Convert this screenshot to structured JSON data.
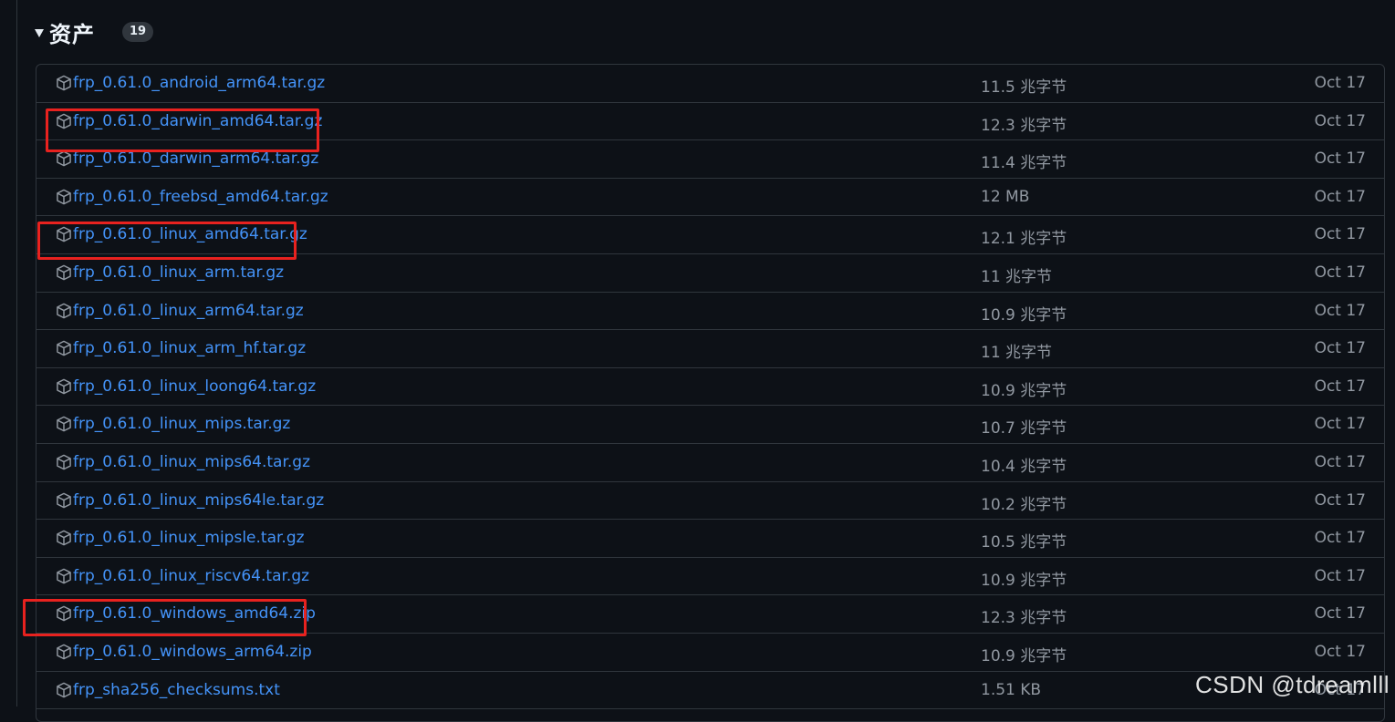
{
  "section": {
    "title": "资产",
    "count": "19"
  },
  "assets": [
    {
      "name": "frp_0.61.0_android_arm64.tar.gz",
      "size": "11.5 兆字节",
      "date": "Oct 17",
      "highlighted": false
    },
    {
      "name": "frp_0.61.0_darwin_amd64.tar.gz",
      "size": "12.3 兆字节",
      "date": "Oct 17",
      "highlighted": true
    },
    {
      "name": "frp_0.61.0_darwin_arm64.tar.gz",
      "size": "11.4 兆字节",
      "date": "Oct 17",
      "highlighted": false
    },
    {
      "name": "frp_0.61.0_freebsd_amd64.tar.gz",
      "size": "12 MB",
      "date": "Oct 17",
      "highlighted": false
    },
    {
      "name": "frp_0.61.0_linux_amd64.tar.gz",
      "size": "12.1 兆字节",
      "date": "Oct 17",
      "highlighted": true
    },
    {
      "name": "frp_0.61.0_linux_arm.tar.gz",
      "size": "11 兆字节",
      "date": "Oct 17",
      "highlighted": false
    },
    {
      "name": "frp_0.61.0_linux_arm64.tar.gz",
      "size": "10.9 兆字节",
      "date": "Oct 17",
      "highlighted": false
    },
    {
      "name": "frp_0.61.0_linux_arm_hf.tar.gz",
      "size": "11 兆字节",
      "date": "Oct 17",
      "highlighted": false
    },
    {
      "name": "frp_0.61.0_linux_loong64.tar.gz",
      "size": "10.9 兆字节",
      "date": "Oct 17",
      "highlighted": false
    },
    {
      "name": "frp_0.61.0_linux_mips.tar.gz",
      "size": "10.7 兆字节",
      "date": "Oct 17",
      "highlighted": false
    },
    {
      "name": "frp_0.61.0_linux_mips64.tar.gz",
      "size": "10.4 兆字节",
      "date": "Oct 17",
      "highlighted": false
    },
    {
      "name": "frp_0.61.0_linux_mips64le.tar.gz",
      "size": "10.2 兆字节",
      "date": "Oct 17",
      "highlighted": false
    },
    {
      "name": "frp_0.61.0_linux_mipsle.tar.gz",
      "size": "10.5 兆字节",
      "date": "Oct 17",
      "highlighted": false
    },
    {
      "name": "frp_0.61.0_linux_riscv64.tar.gz",
      "size": "10.9 兆字节",
      "date": "Oct 17",
      "highlighted": false
    },
    {
      "name": "frp_0.61.0_windows_amd64.zip",
      "size": "12.3 兆字节",
      "date": "Oct 17",
      "highlighted": true
    },
    {
      "name": "frp_0.61.0_windows_arm64.zip",
      "size": "10.9 兆字节",
      "date": "Oct 17",
      "highlighted": false
    },
    {
      "name": "frp_sha256_checksums.txt",
      "size": "1.51 KB",
      "date": "Oct 17",
      "highlighted": false
    }
  ],
  "watermark": "CSDN @tdreamlll",
  "colors": {
    "background": "#0d1117",
    "border": "#30363d",
    "link": "#4493f8",
    "muted": "#9198a1",
    "annotation": "#e8221f"
  },
  "icons": {
    "asset_icon": "package-icon",
    "toggle_icon": "triangle-down-icon"
  }
}
